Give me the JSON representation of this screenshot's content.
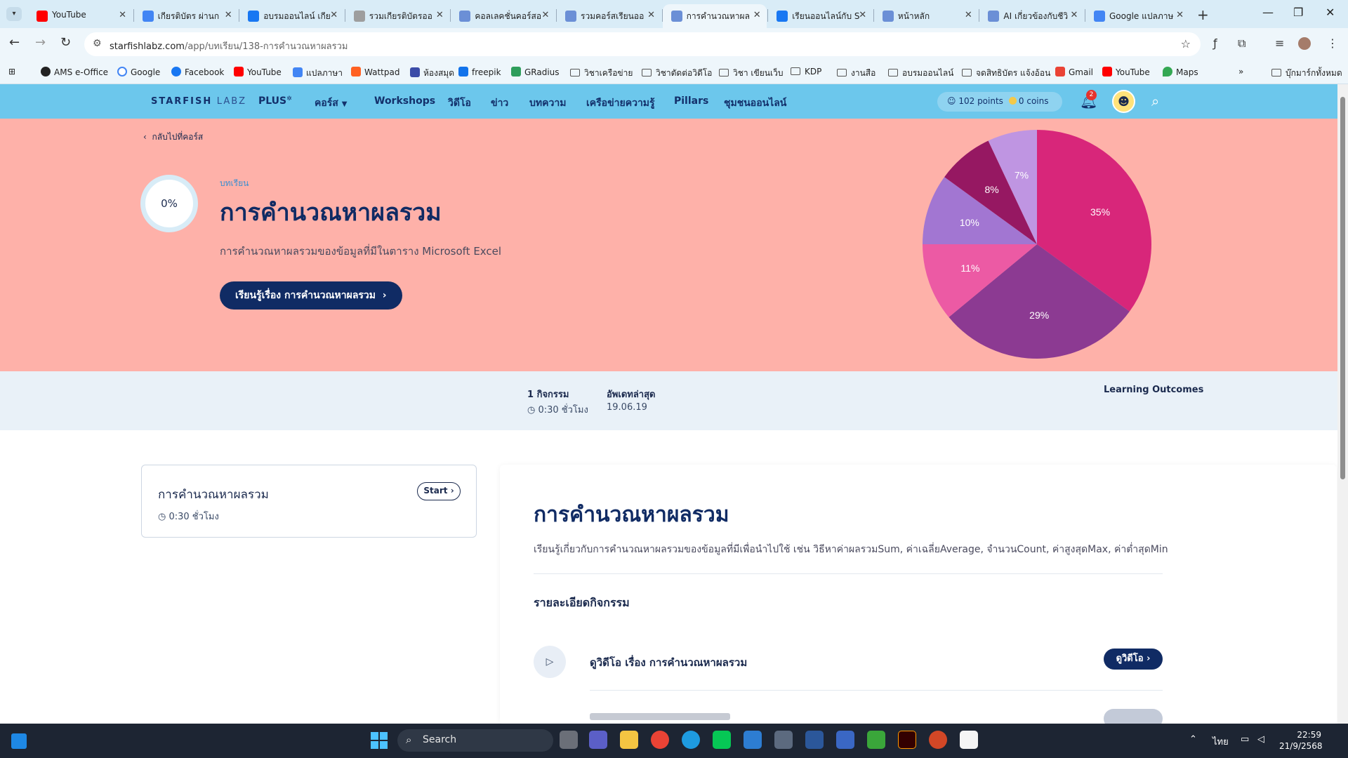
{
  "browser": {
    "tabs": [
      {
        "label": "YouTube",
        "color": "#ff0000"
      },
      {
        "label": "เกียรติบัตร ผ่านก",
        "color": "#4285f4"
      },
      {
        "label": "อบรมออนไลน์ เกีย",
        "color": "#1877f2"
      },
      {
        "label": "รวมเกียรติบัตรออ",
        "color": "#9e9e9e"
      },
      {
        "label": "คอลเลคชั่นคอร์สอ",
        "color": "#6b8fd6"
      },
      {
        "label": "รวมคอร์สเรียนออ",
        "color": "#6b8fd6"
      },
      {
        "label": "การคำนวณหาผล",
        "color": "#6b8fd6"
      },
      {
        "label": "เรียนออนไลน์กับ S",
        "color": "#1877f2"
      },
      {
        "label": "หน้าหลัก",
        "color": "#6b8fd6"
      },
      {
        "label": "AI เกี่ยวข้องกับชีวิ",
        "color": "#6b8fd6"
      },
      {
        "label": "Google แปลภาษ",
        "color": "#4285f4"
      }
    ],
    "active_tab": "การคำนวณหาผล",
    "url_host": "starfishlabz.com",
    "url_path": "/app/บทเรียน/138-การคำนวณหาผลรวม",
    "bookmarks": {
      "ams": "AMS e-Office",
      "google": "Google",
      "facebook": "Facebook",
      "youtube": "YouTube",
      "translate": "แปลภาษา",
      "wattpad": "Wattpad",
      "library": "ห้องสมุด",
      "freepik": "freepik",
      "gradius": "GRadius",
      "f1": "วิชาเครือข่าย",
      "f2": "วิชาตัดต่อวิดีโอ",
      "f3": "วิชา เขียนเว็บ",
      "f4": "KDP",
      "f5": "งานสือ",
      "f6": "อบรมออนไลน์",
      "f7": "จดสิทธิบัตร แจ้งอ้อน",
      "gmail": "Gmail",
      "youtube2": "YouTube",
      "maps": "Maps",
      "all": "บุ๊กมาร์กทั้งหมด"
    }
  },
  "site": {
    "logo_main": "STARFISH",
    "logo_sub": "LABZ",
    "nav": {
      "plus": "PLUS",
      "courses": "คอร์ส",
      "workshops": "Workshops",
      "video": "วิดีโอ",
      "news": "ข่าว",
      "articles": "บทความ",
      "network": "เครือข่ายความรู้",
      "pillars": "Pillars",
      "community": "ชุมชนออนไลน์"
    },
    "points": "102 points",
    "coins": "0 coins",
    "notifications": "2"
  },
  "hero": {
    "back": "กลับไปที่คอร์ส",
    "progress": "0%",
    "kicker": "บทเรียน",
    "title": "การคำนวณหาผลรวม",
    "description": "การคำนวณหาผลรวมของข้อมูลที่มีในตาราง Microsoft Excel",
    "cta": "เรียนรู้เรื่อง การคำนวณหาผลรวม"
  },
  "colors": {
    "pie_slices": [
      "#d8267a",
      "#8c3a92",
      "#ec5aa4",
      "#a276d2",
      "#961862",
      "#bf95e2"
    ]
  },
  "chart_data": {
    "type": "pie",
    "slices": [
      {
        "label": "35%",
        "value": 35
      },
      {
        "label": "29%",
        "value": 29
      },
      {
        "label": "11%",
        "value": 11
      },
      {
        "label": "10%",
        "value": 10
      },
      {
        "label": "8%",
        "value": 8
      },
      {
        "label": "7%",
        "value": 7
      }
    ]
  },
  "info": {
    "activities": "1 กิจกรรม",
    "duration": "0:30 ชั่วโมง",
    "updated_label": "อัพเดทล่าสุด",
    "updated": "19.06.19",
    "outcomes": "Learning Outcomes"
  },
  "lesson_card": {
    "title": "การคำนวณหาผลรวม",
    "time": "0:30 ชั่วโมง",
    "start": "Start"
  },
  "detail": {
    "title": "การคำนวณหาผลรวม",
    "description": "เรียนรู้เกี่ยวกับการคำนวณหาผลรวมของข้อมูลที่มีเพื่อนำไปใช้ เช่น วิธีหาค่าผลรวมSum, ค่าเฉลี่ยAverage, จำนวนCount, ค่าสูงสุดMax, ค่าต่ำสุดMin",
    "activities_heading": "รายละเอียดกิจกรรม",
    "activity_title": "ดูวิดีโอ เรื่อง การคำนวณหาผลรวม",
    "watch": "ดูวิดีโอ"
  },
  "taskbar": {
    "search": "Search",
    "lang": "ไทย",
    "time": "22:59",
    "date": "21/9/2568"
  }
}
